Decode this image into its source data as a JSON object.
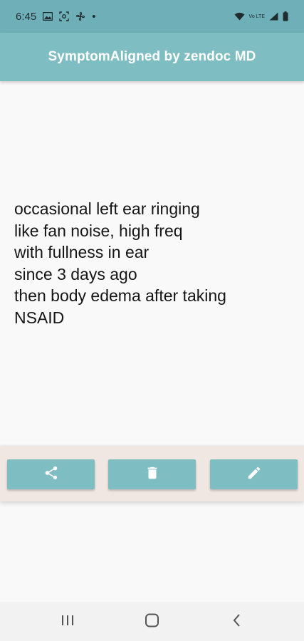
{
  "status_bar": {
    "time": "6:45",
    "dot": "•",
    "network_label": "Vo LTE",
    "icons": [
      "gallery-icon",
      "screenshot-icon",
      "fan-icon",
      "wifi-icon",
      "signal-icon",
      "battery-icon"
    ]
  },
  "app_bar": {
    "title": "SymptomAligned by zendoc MD"
  },
  "note": {
    "lines": [
      "occasional left ear ringing",
      "like fan noise, high freq",
      "with fullness in ear",
      "since 3 days ago",
      "then body edema after taking",
      "NSAID"
    ]
  },
  "actions": {
    "icons": [
      "share-icon",
      "trash-icon",
      "pencil-icon"
    ]
  },
  "nav": {
    "icons": [
      "recents-icon",
      "home-icon",
      "back-icon"
    ]
  },
  "colors": {
    "status_bar": "#6fb0b8",
    "app_bar": "#7ebec3",
    "action_bar": "#f0e6e2",
    "button": "#7ebec3",
    "background": "#f9f9f9"
  }
}
